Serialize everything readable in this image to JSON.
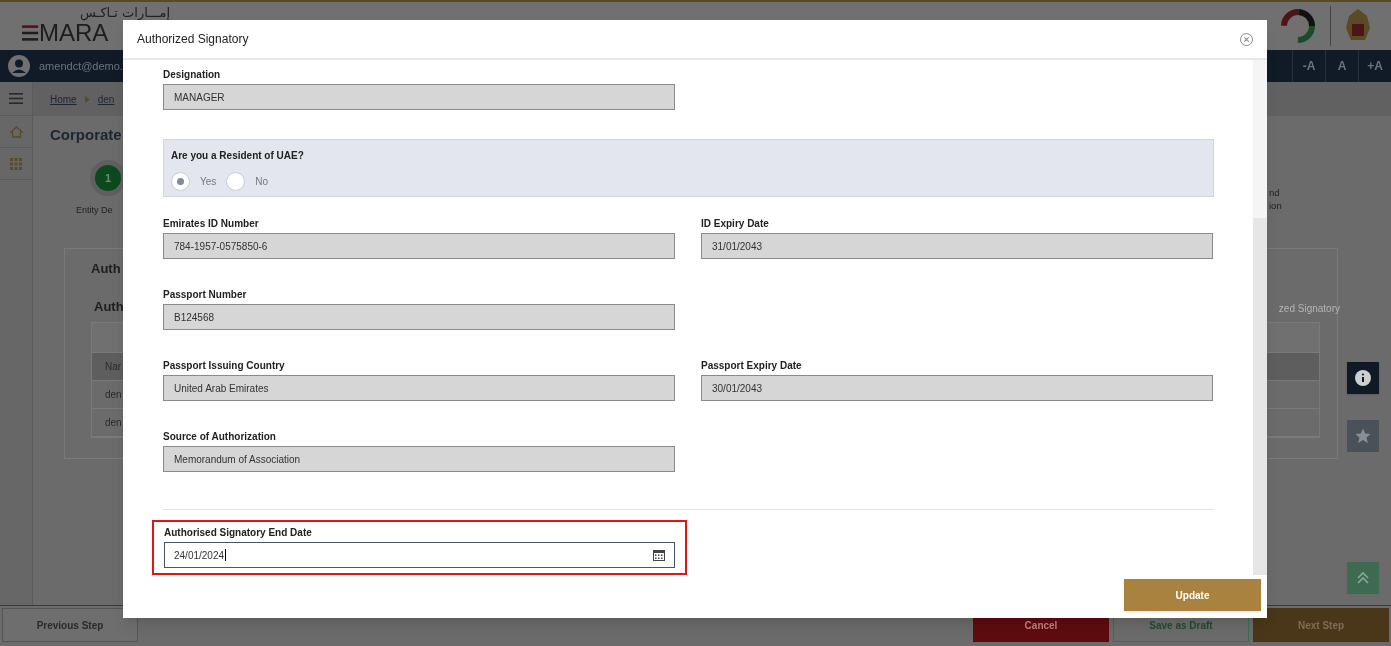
{
  "header": {
    "arabic_logo_text": "إمـــارات تـاكـس",
    "logo_text": "MARA"
  },
  "user_bar": {
    "email": "amendct@demo.",
    "font_buttons": [
      "-A",
      "A",
      "+A"
    ]
  },
  "breadcrumb": [
    "Home",
    "den"
  ],
  "page_title": "Corporate",
  "steps": [
    {
      "number": "1",
      "label": "Entity De"
    }
  ],
  "step_right_label": [
    "nd",
    "ion"
  ],
  "card": {
    "title": "Auth",
    "subtitle": "Auth",
    "right_text": "zed Signatory",
    "table_rows": [
      "Nar",
      "den",
      "den"
    ]
  },
  "footer_buttons": [
    {
      "label": "Previous Step",
      "kind": "secondary"
    },
    {
      "label": "Cancel",
      "kind": "danger"
    },
    {
      "label": "Save as Draft",
      "kind": "outline"
    },
    {
      "label": "Next Step",
      "kind": "primary"
    }
  ],
  "modal": {
    "title": "Authorized Signatory",
    "update_button": "Update",
    "sections": [
      {
        "kind": "field",
        "fields": [
          {
            "label": "Designation",
            "value": "MANAGER"
          }
        ]
      },
      {
        "kind": "radio",
        "question": "Are you a Resident of UAE?",
        "options": [
          {
            "label": "Yes",
            "selected": true
          },
          {
            "label": "No",
            "selected": false
          }
        ]
      },
      {
        "kind": "field",
        "fields": [
          {
            "label": "Emirates ID Number",
            "value": "784-1957-0575850-6"
          },
          {
            "label": "ID Expiry Date",
            "value": "31/01/2043"
          }
        ]
      },
      {
        "kind": "field",
        "fields": [
          {
            "label": "Passport Number",
            "value": "B124568"
          }
        ]
      },
      {
        "kind": "field",
        "fields": [
          {
            "label": "Passport Issuing Country",
            "value": "United Arab Emirates"
          },
          {
            "label": "Passport Expiry Date",
            "value": "30/01/2043"
          }
        ]
      },
      {
        "kind": "field",
        "fields": [
          {
            "label": "Source of Authorization",
            "value": "Memorandum of Association"
          }
        ]
      },
      {
        "kind": "date",
        "label": "Authorised Signatory End Date",
        "value": "24/01/2024",
        "highlighted": true
      }
    ]
  }
}
